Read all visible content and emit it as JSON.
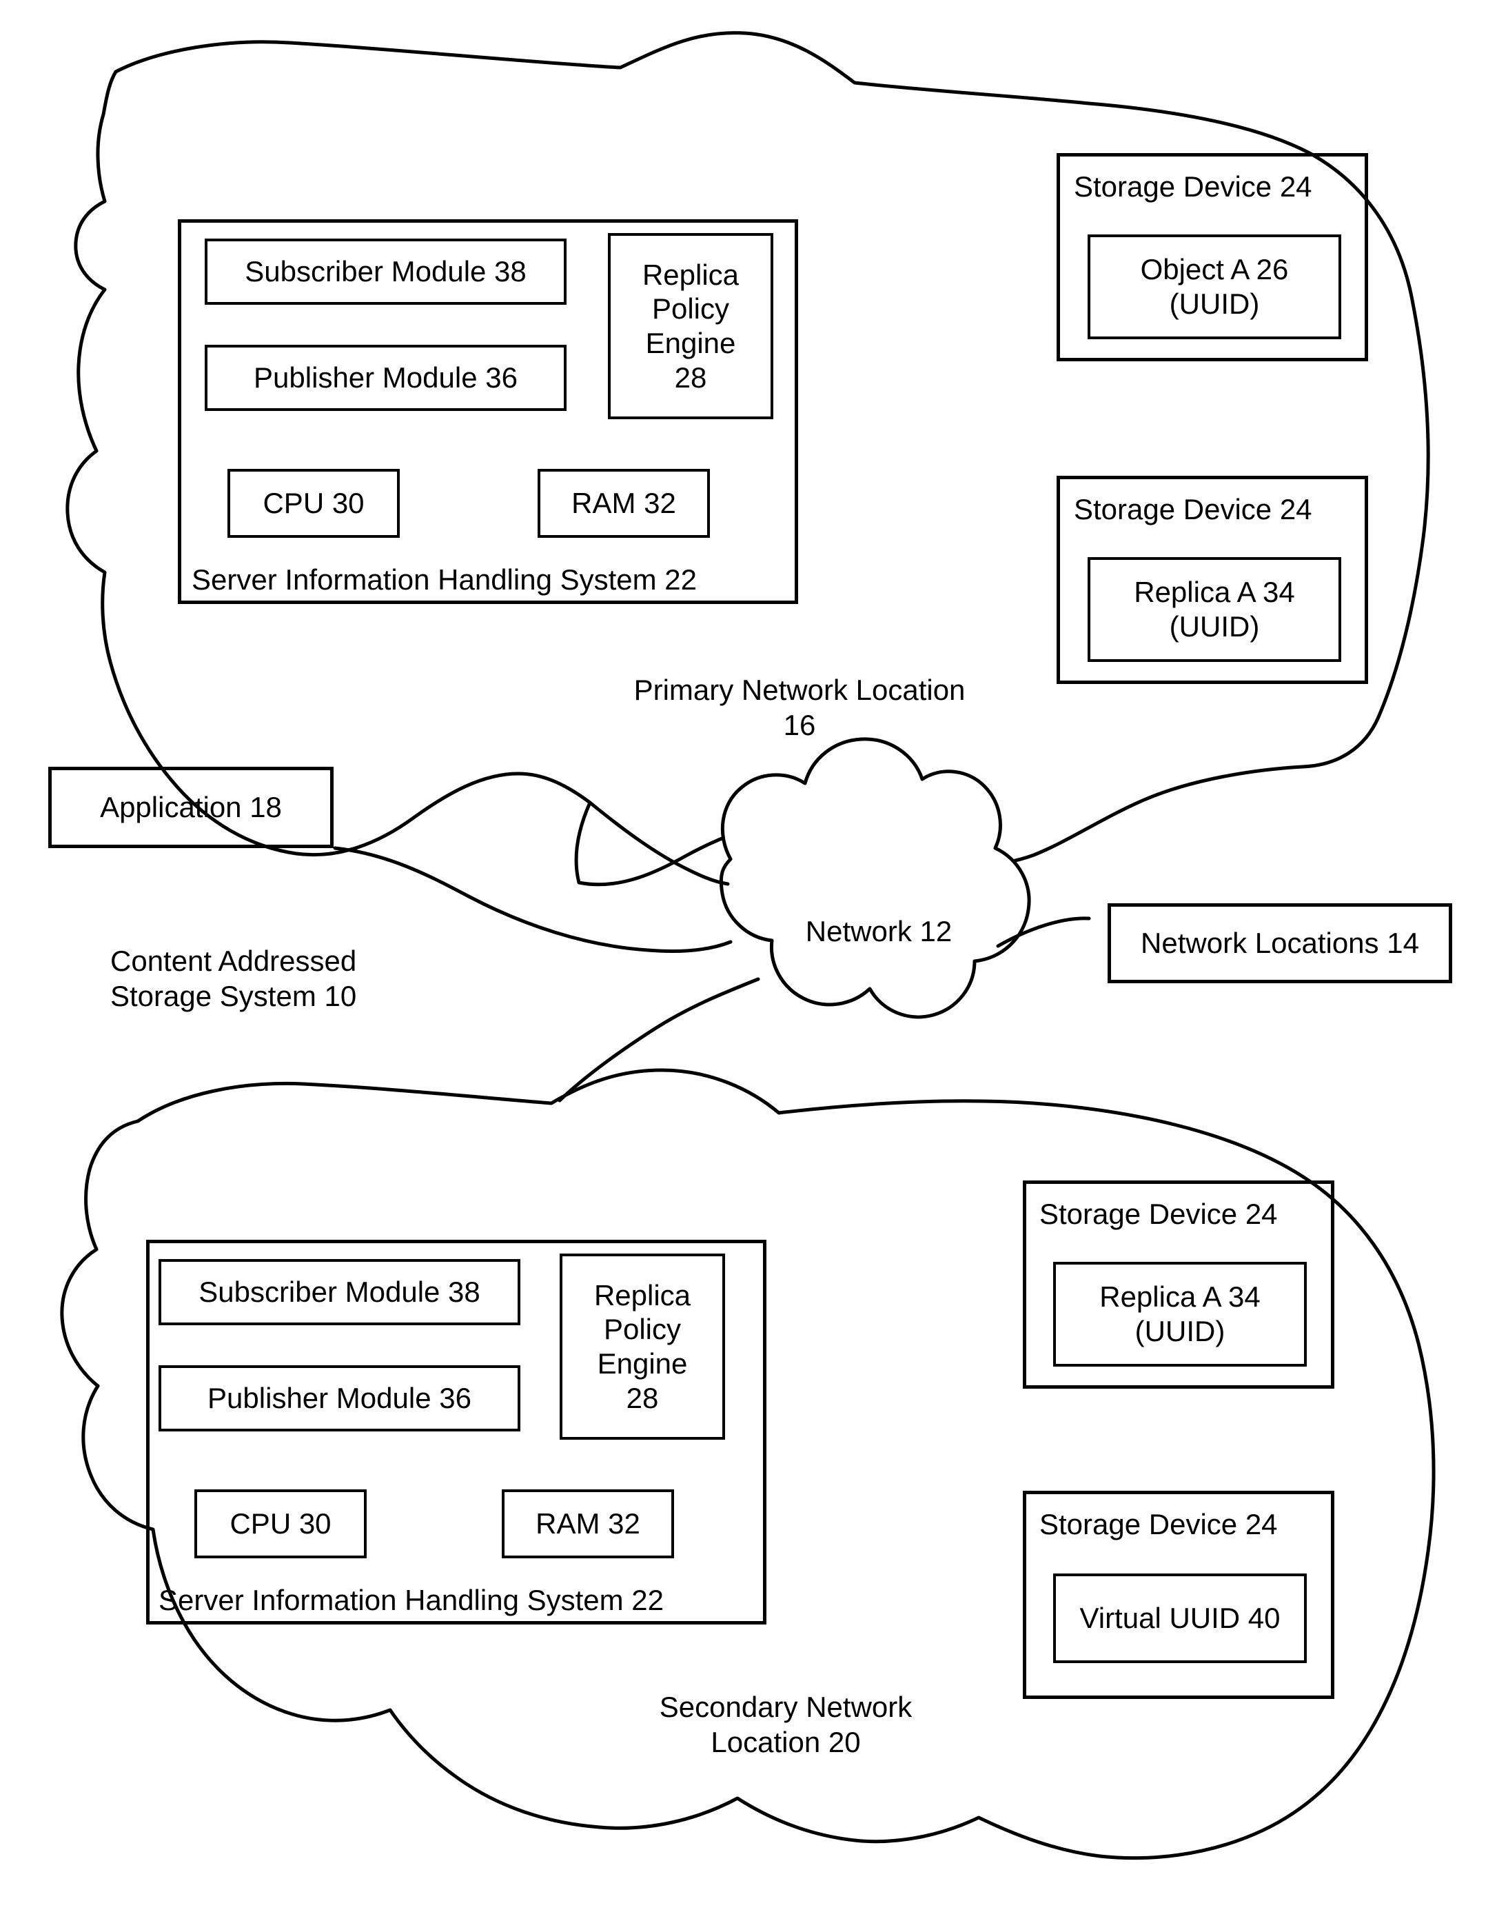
{
  "figure": {
    "system_label": "Content Addressed\nStorage System 10",
    "network_cloud_label": "Network 12",
    "network_locations_label": "Network Locations 14",
    "application_label": "Application 18",
    "primary_location_label": "Primary Network Location\n16",
    "secondary_location_label": "Secondary Network\nLocation 20"
  },
  "primary_location": {
    "server": {
      "title": "Server Information Handling System 22",
      "subscriber_module": "Subscriber Module 38",
      "publisher_module": "Publisher Module 36",
      "replica_policy_engine": "Replica\nPolicy\nEngine\n28",
      "cpu": "CPU 30",
      "ram": "RAM 32"
    },
    "storage_devices": [
      {
        "title": "Storage Device 24",
        "content": "Object A 26\n(UUID)"
      },
      {
        "title": "Storage Device 24",
        "content": "Replica A 34\n(UUID)"
      }
    ]
  },
  "secondary_location": {
    "server": {
      "title": "Server Information Handling System 22",
      "subscriber_module": "Subscriber Module 38",
      "publisher_module": "Publisher Module 36",
      "replica_policy_engine": "Replica\nPolicy\nEngine\n28",
      "cpu": "CPU 30",
      "ram": "RAM 32"
    },
    "storage_devices": [
      {
        "title": "Storage Device 24",
        "content": "Replica A 34\n(UUID)"
      },
      {
        "title": "Storage Device 24",
        "content": "Virtual UUID 40"
      }
    ]
  },
  "colors": {
    "stroke": "#000000",
    "background": "#ffffff"
  }
}
